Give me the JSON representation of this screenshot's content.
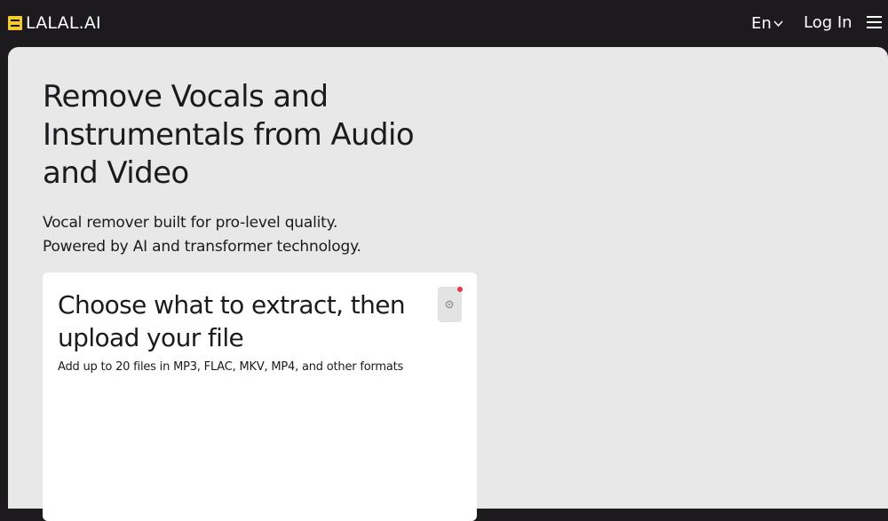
{
  "header": {
    "logo_text": "LALAL.AI",
    "language_label": "En",
    "login_label": "Log In"
  },
  "hero": {
    "title": "Remove Vocals and Instrumentals from Audio and Video",
    "subtitle_line1": "Vocal remover built for pro-level quality.",
    "subtitle_line2": "Powered by AI and transformer technology."
  },
  "upload_card": {
    "title": "Choose what to extract, then upload your file",
    "hint": "Add up to 20 files in MP3, FLAC, MKV, MP4, and other formats"
  },
  "icons": {
    "logo": "lalal-logo-icon",
    "language_dropdown": "chevron-down-icon",
    "menu": "hamburger-menu-icon",
    "settings": "gear-icon",
    "notification": "notification-dot-icon"
  },
  "colors": {
    "top_bar": "#1c1a1d",
    "content_background": "#e8e8e8",
    "card_background": "#ffffff",
    "logo_accent": "#f2cc2f",
    "notification_dot": "#e8364b"
  }
}
